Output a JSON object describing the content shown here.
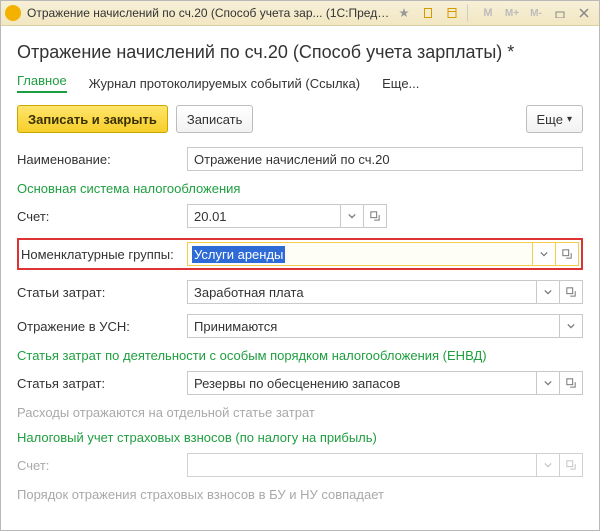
{
  "window": {
    "title": "Отражение начислений по сч.20 (Способ учета зар... (1С:Предприятие)"
  },
  "page": {
    "title": "Отражение начислений по сч.20 (Способ учета зарплаты) *"
  },
  "tabs": {
    "main": "Главное",
    "log": "Журнал протоколируемых событий (Ссылка)",
    "more": "Еще..."
  },
  "toolbar": {
    "save_close": "Записать и закрыть",
    "save": "Записать",
    "more": "Еще"
  },
  "fields": {
    "name_label": "Наименование:",
    "name_value": "Отражение начислений по сч.20",
    "tax_header": "Основная система налогообложения",
    "account_label": "Счет:",
    "account_value": "20.01",
    "nomgroup_label": "Номенклатурные группы:",
    "nomgroup_value": "Услуги аренды",
    "cost_items_label": "Статьи затрат:",
    "cost_items_value": "Заработная плата",
    "usn_label": "Отражение в УСН:",
    "usn_value": "Принимаются",
    "envd_header": "Статья затрат по деятельности с особым порядком налогообложения (ЕНВД)",
    "envd_cost_label": "Статья затрат:",
    "envd_cost_value": "Резервы по обесценению запасов",
    "envd_hint": "Расходы отражаются на отдельной статье затрат",
    "ins_header": "Налоговый учет страховых взносов (по налогу на прибыль)",
    "ins_account_label": "Счет:",
    "ins_account_value": "",
    "bottom_hint": "Порядок отражения страховых взносов в БУ и НУ совпадает"
  }
}
